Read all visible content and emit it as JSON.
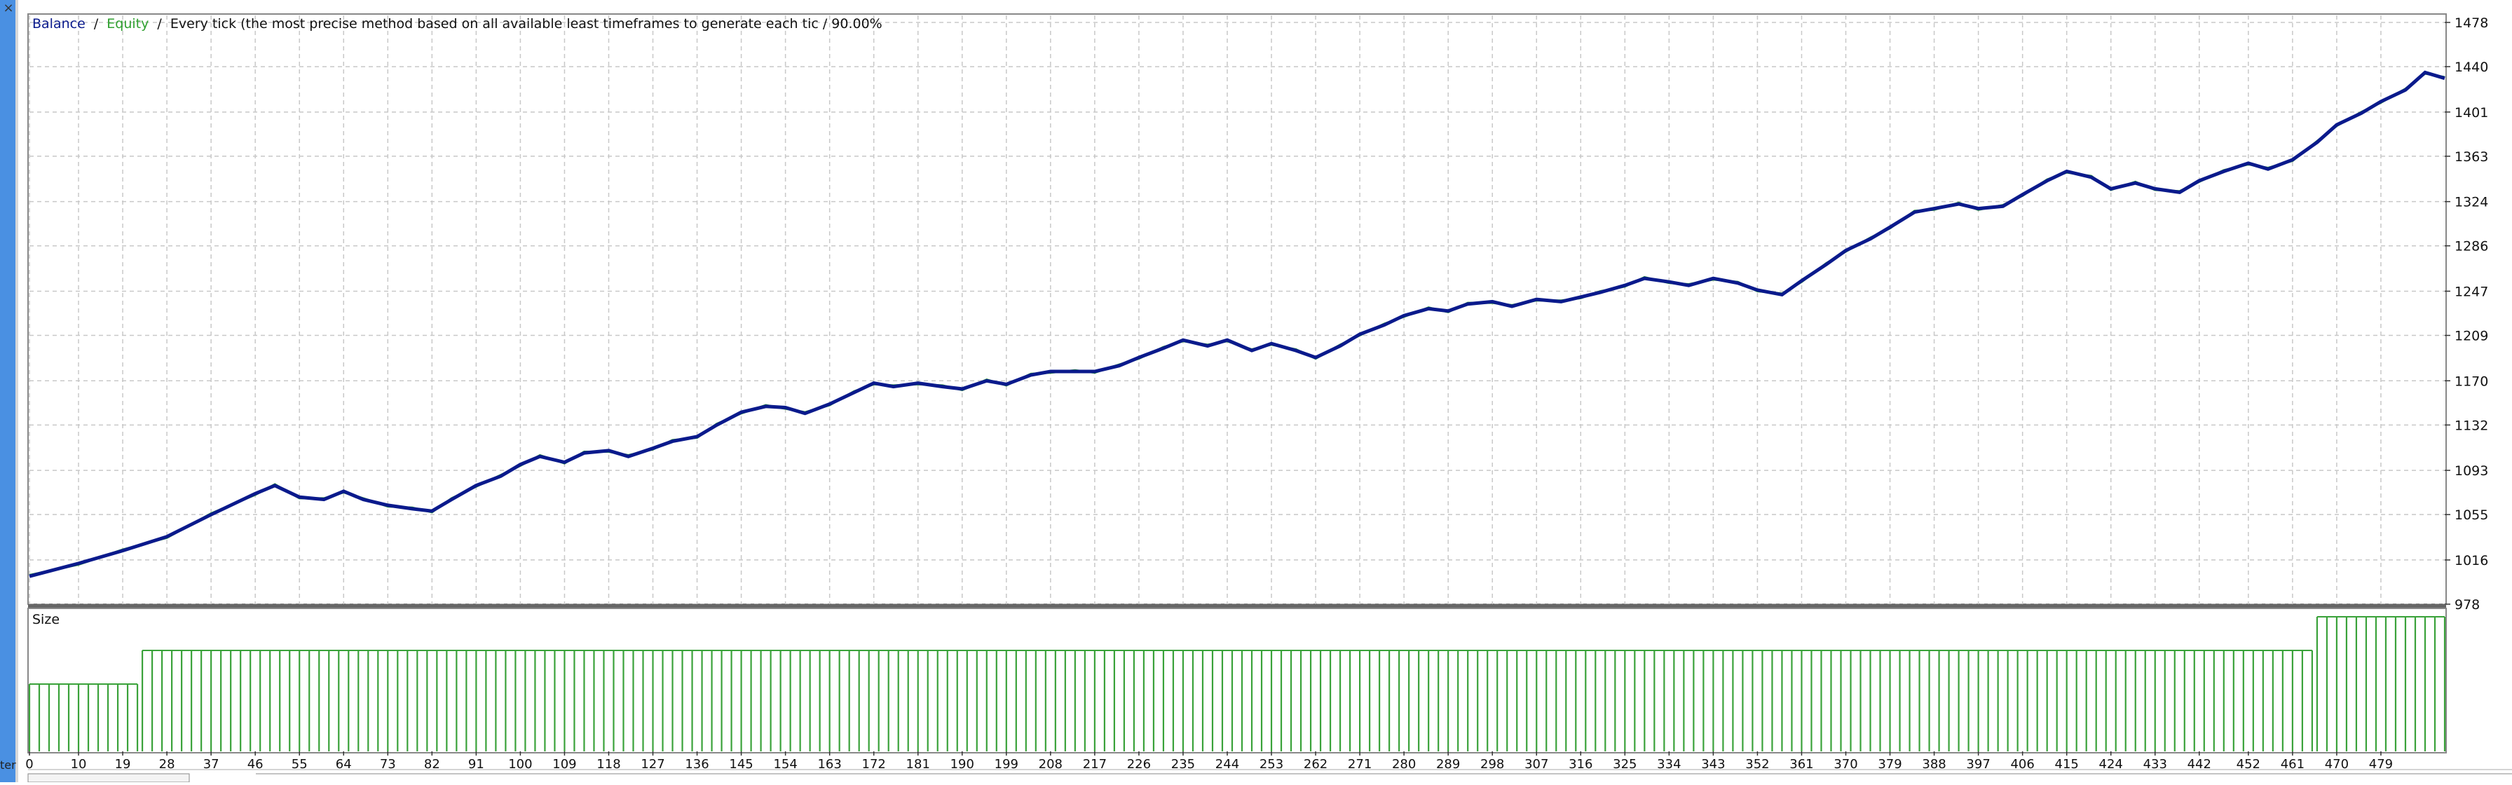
{
  "window": {
    "close_glyph": "×",
    "side_tab_label": "ter"
  },
  "legend": {
    "balance_label": "Balance",
    "sep1": "/",
    "equity_label": "Equity",
    "sep2": "/",
    "description": "Every tick (the most precise method based on all available least timeframes to generate each tic / 90.00%"
  },
  "colors": {
    "balance": "#0a1a8c",
    "equity": "#2fa02f",
    "size_bars": "#3aa23a",
    "grid": "#c8c8c8",
    "text": "#111111",
    "left_strip": "#4a90e2"
  },
  "chart_data": [
    {
      "type": "line",
      "title": "",
      "ylim": [
        978,
        1478
      ],
      "yticks": [
        "1478",
        "1440",
        "1401",
        "1363",
        "1324",
        "1286",
        "1247",
        "1209",
        "1170",
        "1132",
        "1093",
        "1055",
        "1016",
        "978"
      ],
      "grid": true,
      "x_range": [
        0,
        492
      ],
      "series": [
        {
          "name": "Balance",
          "x": [
            0,
            10,
            19,
            28,
            37,
            46,
            50,
            55,
            60,
            64,
            68,
            73,
            78,
            82,
            86,
            91,
            96,
            100,
            104,
            109,
            113,
            118,
            122,
            127,
            131,
            136,
            140,
            145,
            150,
            154,
            158,
            163,
            168,
            172,
            176,
            181,
            186,
            190,
            195,
            199,
            204,
            208,
            213,
            217,
            222,
            226,
            231,
            235,
            240,
            244,
            249,
            253,
            258,
            262,
            267,
            271,
            276,
            280,
            285,
            289,
            293,
            298,
            302,
            307,
            312,
            316,
            320,
            325,
            329,
            334,
            338,
            343,
            348,
            352,
            357,
            361,
            366,
            370,
            375,
            379,
            384,
            388,
            393,
            397,
            402,
            406,
            411,
            415,
            420,
            424,
            429,
            433,
            438,
            442,
            447,
            452,
            456,
            461,
            466,
            470,
            475,
            479,
            484,
            488,
            492
          ],
          "values": [
            1002,
            1013,
            1024,
            1036,
            1055,
            1073,
            1080,
            1070,
            1068,
            1075,
            1068,
            1063,
            1060,
            1058,
            1068,
            1080,
            1088,
            1098,
            1105,
            1100,
            1108,
            1110,
            1105,
            1112,
            1118,
            1122,
            1132,
            1143,
            1148,
            1147,
            1142,
            1150,
            1160,
            1168,
            1165,
            1168,
            1165,
            1163,
            1170,
            1167,
            1175,
            1178,
            1178,
            1178,
            1183,
            1190,
            1198,
            1205,
            1200,
            1205,
            1196,
            1202,
            1196,
            1190,
            1200,
            1210,
            1218,
            1226,
            1232,
            1230,
            1236,
            1238,
            1234,
            1240,
            1238,
            1242,
            1246,
            1252,
            1258,
            1255,
            1252,
            1258,
            1254,
            1248,
            1244,
            1256,
            1270,
            1282,
            1292,
            1302,
            1315,
            1318,
            1322,
            1318,
            1320,
            1330,
            1342,
            1350,
            1345,
            1335,
            1340,
            1335,
            1332,
            1342,
            1350,
            1357,
            1352,
            1360,
            1375,
            1390,
            1400,
            1410,
            1420,
            1435,
            1430
          ]
        },
        {
          "name": "Equity",
          "x": [
            0,
            10,
            19,
            28,
            37,
            46,
            50,
            55,
            60,
            64,
            68,
            73,
            78,
            82,
            86,
            91,
            96,
            100,
            104,
            109,
            113,
            118,
            122,
            127,
            131,
            136,
            140,
            145,
            150,
            154,
            158,
            163,
            168,
            172,
            176,
            181,
            186,
            190,
            195,
            199,
            204,
            208,
            213,
            217,
            222,
            226,
            231,
            235,
            240,
            244,
            249,
            253,
            258,
            262,
            267,
            271,
            276,
            280,
            285,
            289,
            293,
            298,
            302,
            307,
            312,
            316,
            320,
            325,
            329,
            334,
            338,
            343,
            348,
            352,
            357,
            361,
            366,
            370,
            375,
            379,
            384,
            388,
            393,
            397,
            402,
            406,
            411,
            415,
            420,
            424,
            429,
            433,
            438,
            442,
            447,
            452,
            456,
            461,
            466,
            470,
            475,
            479,
            484,
            488,
            492
          ],
          "values": [
            1003,
            1012,
            1025,
            1035,
            1056,
            1072,
            1081,
            1069,
            1069,
            1074,
            1069,
            1062,
            1061,
            1057,
            1069,
            1079,
            1089,
            1097,
            1106,
            1099,
            1109,
            1109,
            1106,
            1111,
            1119,
            1121,
            1133,
            1142,
            1149,
            1146,
            1143,
            1149,
            1161,
            1167,
            1166,
            1167,
            1166,
            1162,
            1171,
            1166,
            1176,
            1177,
            1179,
            1177,
            1184,
            1189,
            1199,
            1204,
            1201,
            1204,
            1197,
            1201,
            1197,
            1189,
            1201,
            1209,
            1219,
            1225,
            1233,
            1229,
            1237,
            1237,
            1235,
            1239,
            1239,
            1241,
            1247,
            1251,
            1259,
            1254,
            1253,
            1257,
            1255,
            1247,
            1245,
            1255,
            1271,
            1281,
            1293,
            1301,
            1316,
            1317,
            1323,
            1317,
            1321,
            1329,
            1343,
            1349,
            1346,
            1334,
            1341,
            1334,
            1333,
            1341,
            1351,
            1356,
            1353,
            1359,
            1376,
            1389,
            1401,
            1409,
            1421,
            1434,
            1431
          ]
        }
      ]
    },
    {
      "type": "bar",
      "title": "Size",
      "x_ticks": [
        "0",
        "10",
        "19",
        "28",
        "37",
        "46",
        "55",
        "64",
        "73",
        "82",
        "91",
        "100",
        "109",
        "118",
        "127",
        "136",
        "145",
        "154",
        "163",
        "172",
        "181",
        "190",
        "199",
        "208",
        "217",
        "226",
        "235",
        "244",
        "253",
        "262",
        "271",
        "280",
        "289",
        "298",
        "307",
        "316",
        "325",
        "334",
        "343",
        "352",
        "361",
        "370",
        "379",
        "388",
        "397",
        "406",
        "415",
        "424",
        "433",
        "442",
        "452",
        "461",
        "470",
        "479"
      ],
      "x_range": [
        0,
        492
      ],
      "segments": [
        {
          "from": 0,
          "to": 22,
          "value": 0.5
        },
        {
          "from": 23,
          "to": 465,
          "value": 0.75
        },
        {
          "from": 466,
          "to": 492,
          "value": 1.0
        }
      ],
      "ylim": [
        0,
        1
      ]
    }
  ]
}
